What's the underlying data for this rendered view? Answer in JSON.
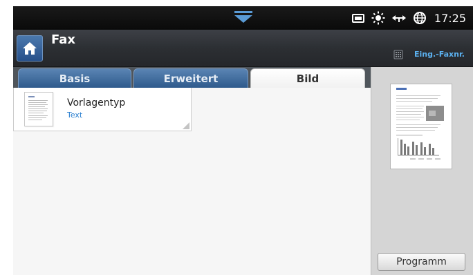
{
  "status": {
    "time": "17:25"
  },
  "header": {
    "title": "Fax",
    "fax_id_label": "Eing.-Faxnr."
  },
  "tabs": [
    {
      "label": "Basis"
    },
    {
      "label": "Erweitert"
    },
    {
      "label": "Bild"
    }
  ],
  "active_tab": "Bild",
  "options": [
    {
      "title": "Vorlagentyp",
      "value": "Text"
    }
  ],
  "preview": {
    "program_label": "Programm"
  },
  "colors": {
    "accent_blue": "#2a7fd0",
    "tab_blue": "#3f6c9f",
    "header_dark": "#2c2f33",
    "fax_id_text": "#5bb0ee"
  }
}
